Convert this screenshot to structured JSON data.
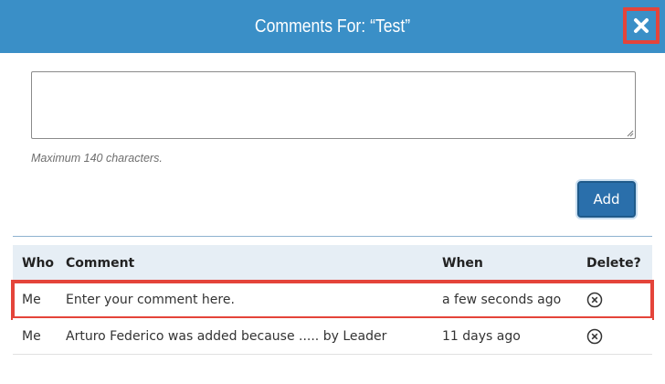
{
  "dialog": {
    "title": "Comments For: “Test”",
    "close_icon": "close-icon",
    "header_color": "#3a8fc7"
  },
  "form": {
    "comment_value": "",
    "hint": "Maximum 140 characters.",
    "add_label": "Add"
  },
  "table": {
    "headers": {
      "who": "Who",
      "comment": "Comment",
      "when": "When",
      "delete": "Delete?"
    },
    "rows": [
      {
        "who": "Me",
        "comment": "Enter your comment here.",
        "when": "a few seconds ago",
        "delete_icon": "delete-circle-x-icon",
        "highlighted": true
      },
      {
        "who": "Me",
        "comment": "Arturo Federico was added because ..... by Leader",
        "when": "11 days ago",
        "delete_icon": "delete-circle-x-icon",
        "highlighted": false
      }
    ]
  },
  "colors": {
    "highlight": "#e4443a",
    "button": "#2a6fab"
  }
}
